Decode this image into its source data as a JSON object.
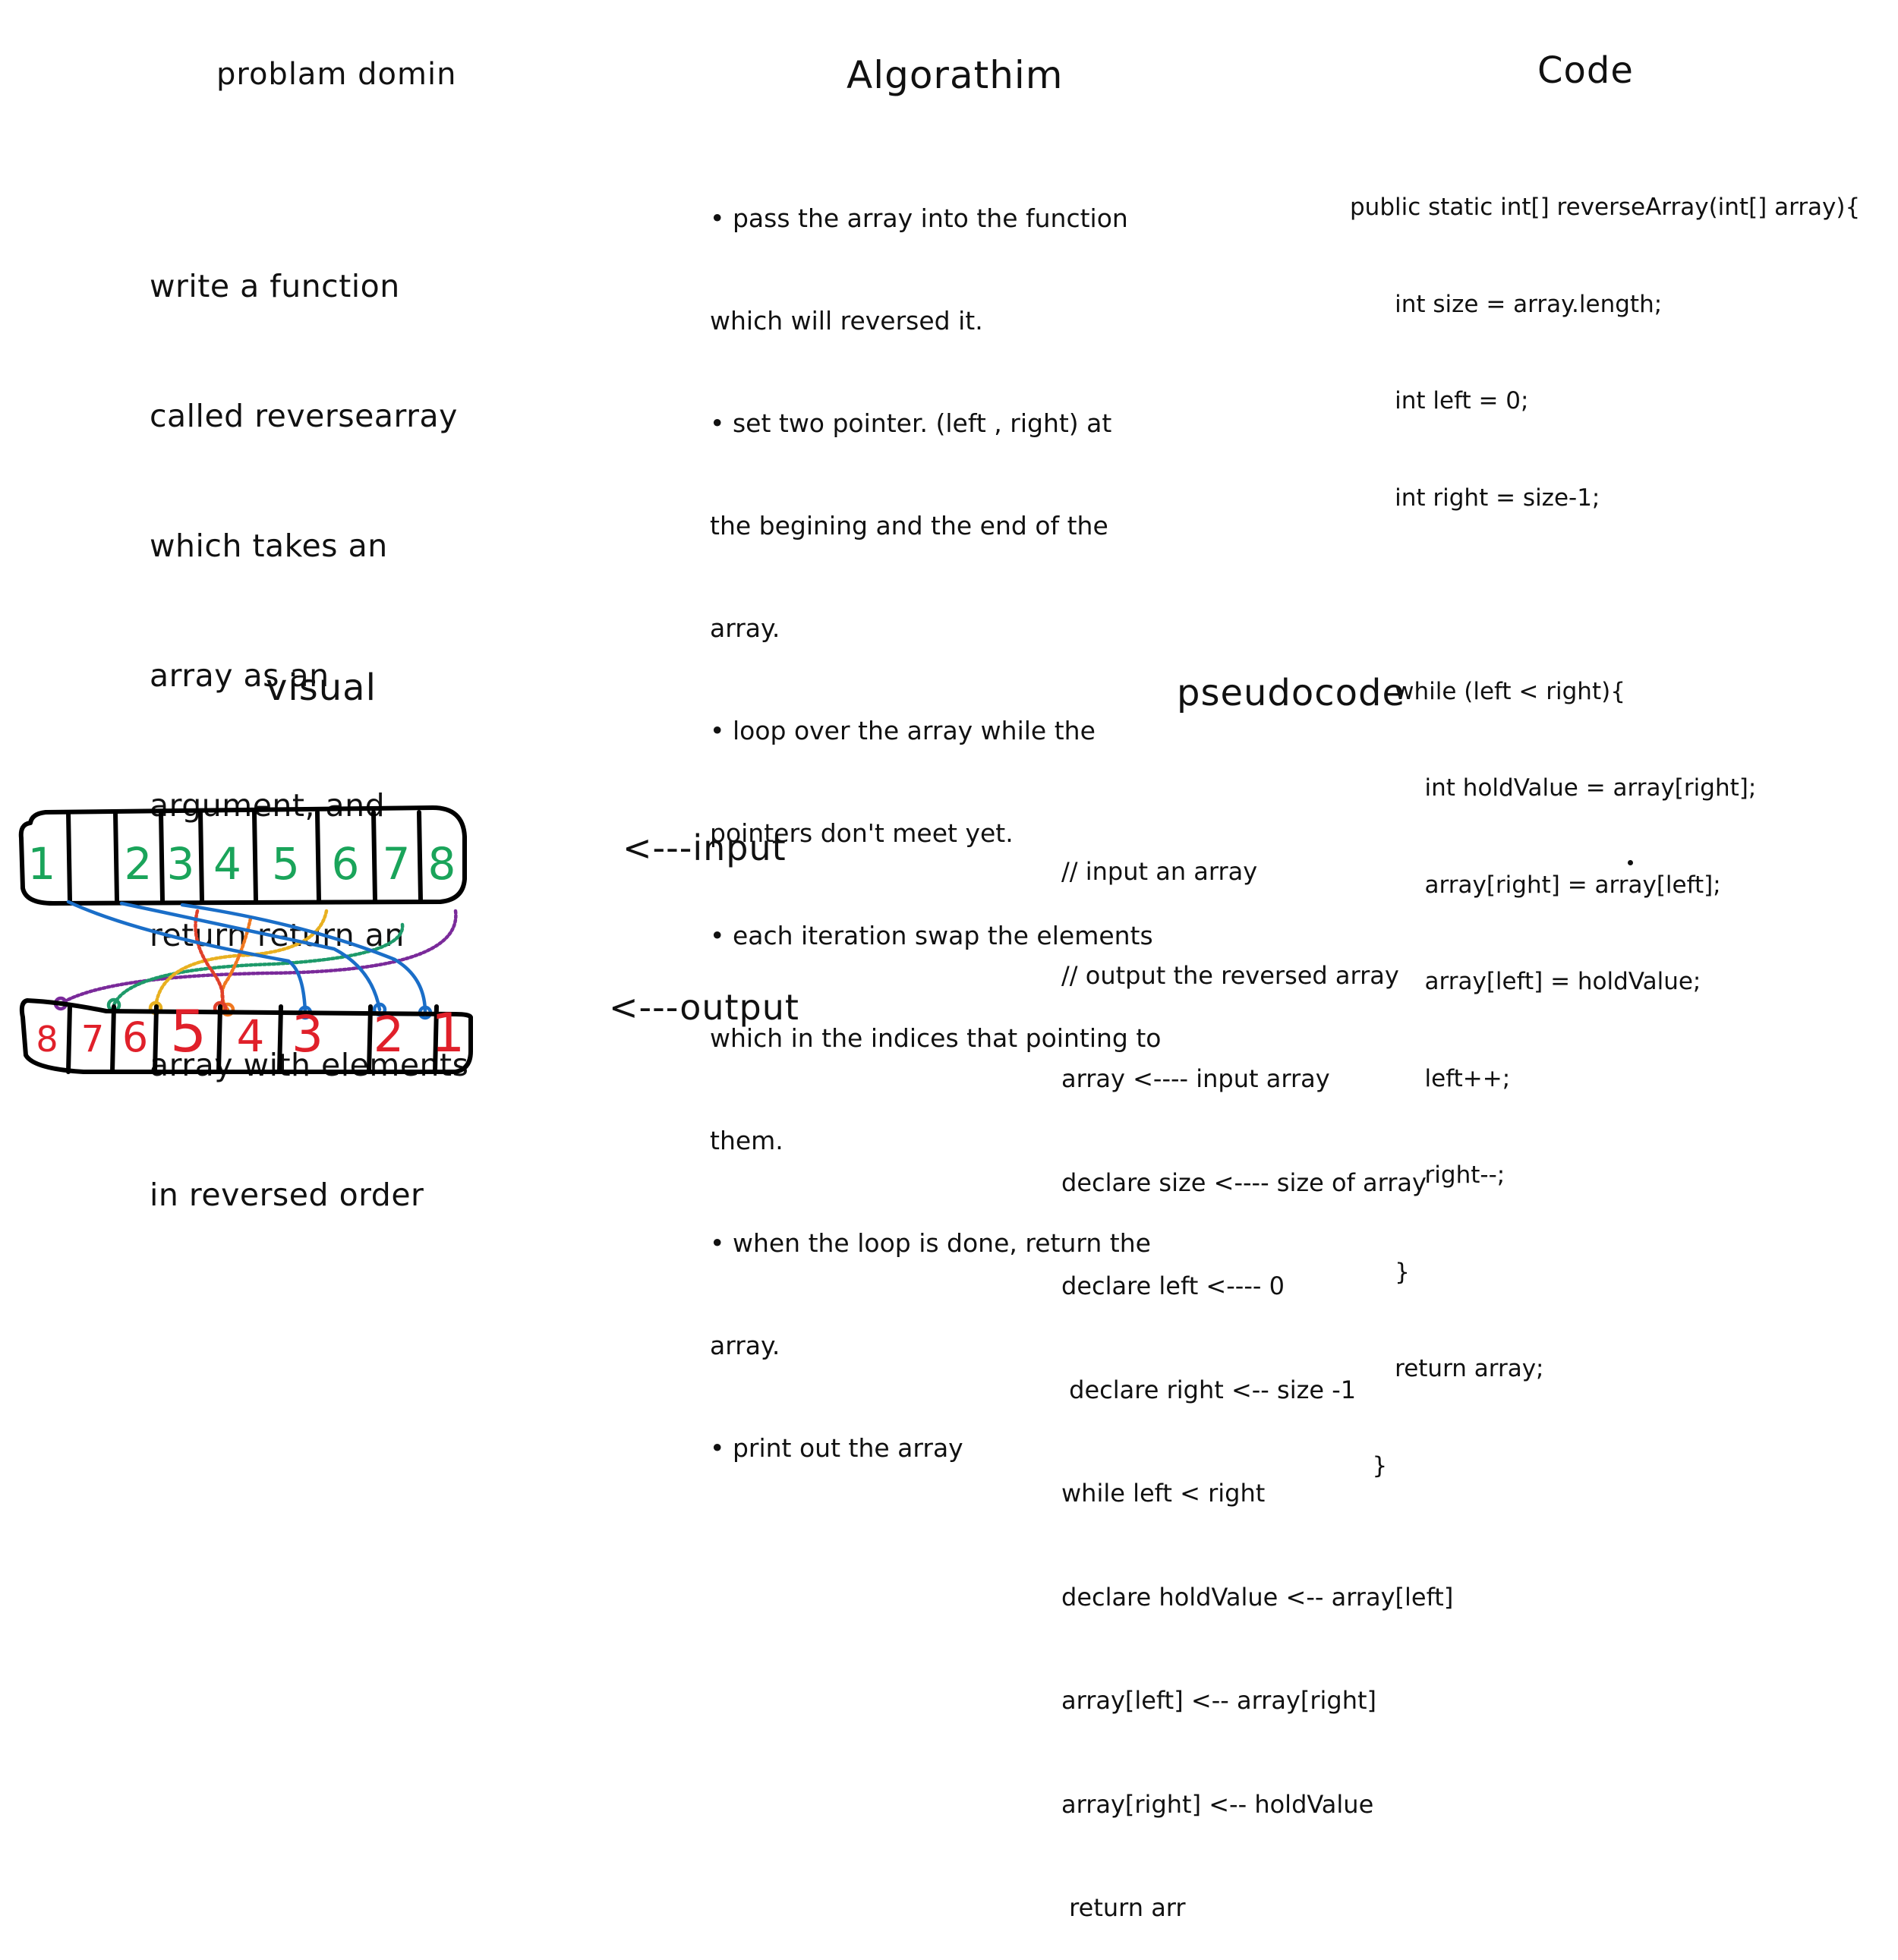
{
  "sections": {
    "problem": {
      "title": "problam domin",
      "lines": [
        "write a function",
        "called reversearray",
        "which takes an",
        "array as an",
        "argument, and",
        "return return an",
        "array with elements",
        "in reversed order"
      ]
    },
    "algorithm": {
      "title": "Algorathim",
      "lines": [
        "• pass the array into the function",
        "which will reversed it.",
        "• set two pointer. (left , right) at",
        "the begining and the end of the",
        "array.",
        "• loop over the array while the",
        "pointers don't meet yet.",
        "• each iteration swap the elements",
        "which in the indices that pointing to",
        "them.",
        "• when the loop is done, return the",
        "array.",
        "• print out the array"
      ]
    },
    "code": {
      "title": "Code",
      "lines": [
        "public static int[] reverseArray(int[] array){",
        "      int size = array.length;",
        "      int left = 0;",
        "      int right = size-1;",
        "",
        "      while (left < right){",
        "          int holdValue = array[right];",
        "          array[right] = array[left];",
        "          array[left] = holdValue;",
        "          left++;",
        "          right--;",
        "      }",
        "      return array;",
        "   }"
      ]
    },
    "visual": {
      "title": "visual",
      "input_label": "<---input",
      "output_label": "<---output",
      "input_values": [
        "1",
        "2",
        "3",
        "4",
        "5",
        "6",
        "7",
        "8"
      ],
      "output_values": [
        "8",
        "7",
        "6",
        "5",
        "4",
        "3",
        "2",
        "1"
      ],
      "input_color": "#1aa45a",
      "output_color": "#e0202a",
      "arrow_colors": [
        "#7a2a9a",
        "#1e9a6a",
        "#e8b020",
        "#f07820",
        "#e0402a",
        "#1a6ec8",
        "#1a6ec8",
        "#1a6ec8"
      ]
    },
    "pseudocode": {
      "title": "pseudocode",
      "lines": [
        "// input an array",
        "// output the reversed array",
        "array <---- input array",
        "declare size <---- size of array",
        "declare left <---- 0",
        " declare right <-- size -1",
        "while left < right",
        "declare holdValue <-- array[left]",
        "array[left] <-- array[right]",
        "array[right] <-- holdValue",
        " return arr"
      ]
    }
  }
}
